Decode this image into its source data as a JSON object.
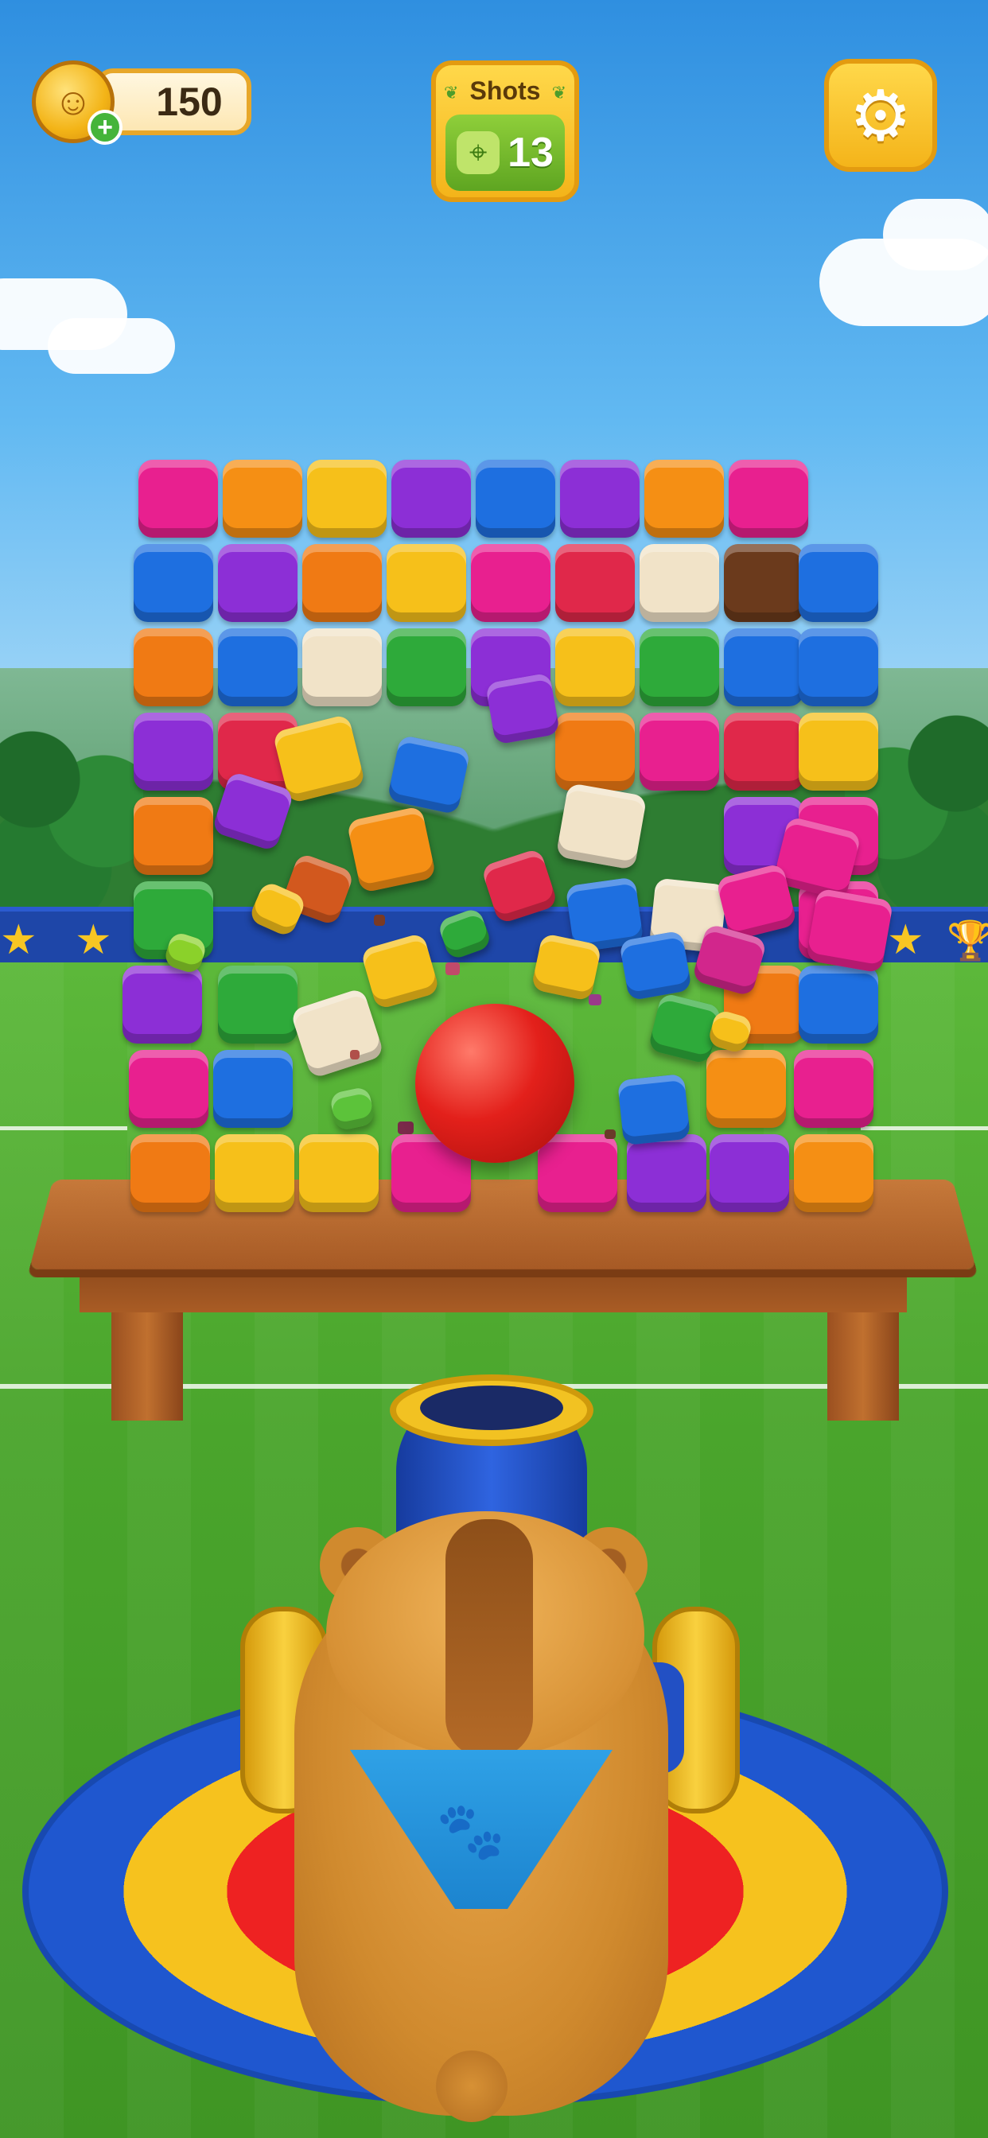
{
  "hud": {
    "coins": {
      "value": "150",
      "plus_label": "+"
    },
    "shots": {
      "title": "Shots",
      "count": "13"
    },
    "settings": {
      "icon": "gear-icon"
    }
  },
  "scene": {
    "projectile": "red-ball",
    "character": "capybara-with-blue-bandana",
    "launcher": "blue-cannon"
  },
  "colors": {
    "pink": "#e8208f",
    "orange": "#f07a14",
    "yellow": "#f6c01a",
    "purple": "#8c2fd6",
    "blue": "#1e6fe0",
    "red": "#e0284a",
    "cream": "#f1e3c8",
    "brown": "#6b3a1c",
    "green": "#2eaa3a",
    "magenta": "#d2268c"
  }
}
